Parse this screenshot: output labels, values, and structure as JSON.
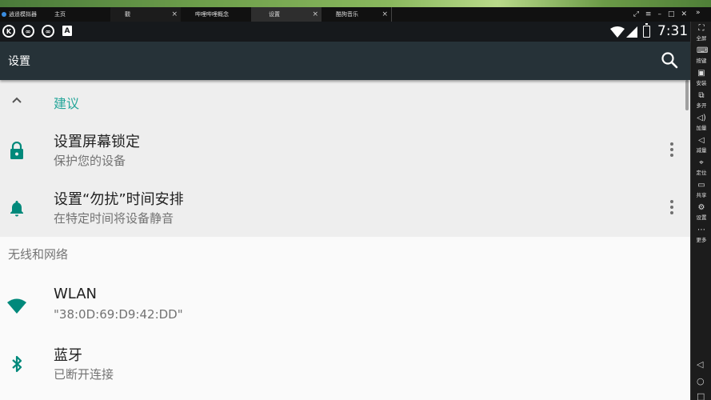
{
  "emulator": {
    "tabs": [
      {
        "label": "逍遥模拟器",
        "active": false
      },
      {
        "label": "主页",
        "active": false
      },
      {
        "label": "觀",
        "active": false
      },
      {
        "label": "哔哩哔哩概念",
        "active": false
      },
      {
        "label": "设置",
        "active": true
      },
      {
        "label": "酷狗音乐",
        "active": false
      }
    ],
    "close_glyph": "×",
    "sidebar": [
      {
        "label": "全屏",
        "icon": "fullscreen-icon"
      },
      {
        "label": "按键",
        "icon": "keyboard-icon"
      },
      {
        "label": "安装",
        "icon": "install-apk-icon"
      },
      {
        "label": "多开",
        "icon": "multi-instance-icon"
      },
      {
        "label": "加量",
        "icon": "volume-up-icon"
      },
      {
        "label": "减量",
        "icon": "volume-down-icon"
      },
      {
        "label": "定位",
        "icon": "location-pin-icon"
      },
      {
        "label": "共享",
        "icon": "folder-share-icon"
      },
      {
        "label": "设置",
        "icon": "gear-icon"
      },
      {
        "label": "更多",
        "icon": "more-dots-icon"
      }
    ]
  },
  "status_bar": {
    "time": "7:31",
    "a_badge": "A"
  },
  "toolbar": {
    "title": "设置"
  },
  "suggestions": {
    "title": "建议",
    "items": [
      {
        "title": "设置屏幕锁定",
        "subtitle": "保护您的设备",
        "icon": "lock-icon"
      },
      {
        "title": "设置“勿扰”时间安排",
        "subtitle": "在特定时间将设备静音",
        "icon": "bell-icon"
      }
    ]
  },
  "section": {
    "title": "无线和网络",
    "items": [
      {
        "title": "WLAN",
        "subtitle": "\"38:0D:69:D9:42:DD\"",
        "icon": "wifi-icon"
      },
      {
        "title": "蓝牙",
        "subtitle": "已断开连接",
        "icon": "bluetooth-icon"
      }
    ]
  },
  "colors": {
    "toolbar": "#263238",
    "accent": "#26a69a",
    "suggestion_bg": "#eeeeee",
    "page_bg": "#fafafa"
  }
}
